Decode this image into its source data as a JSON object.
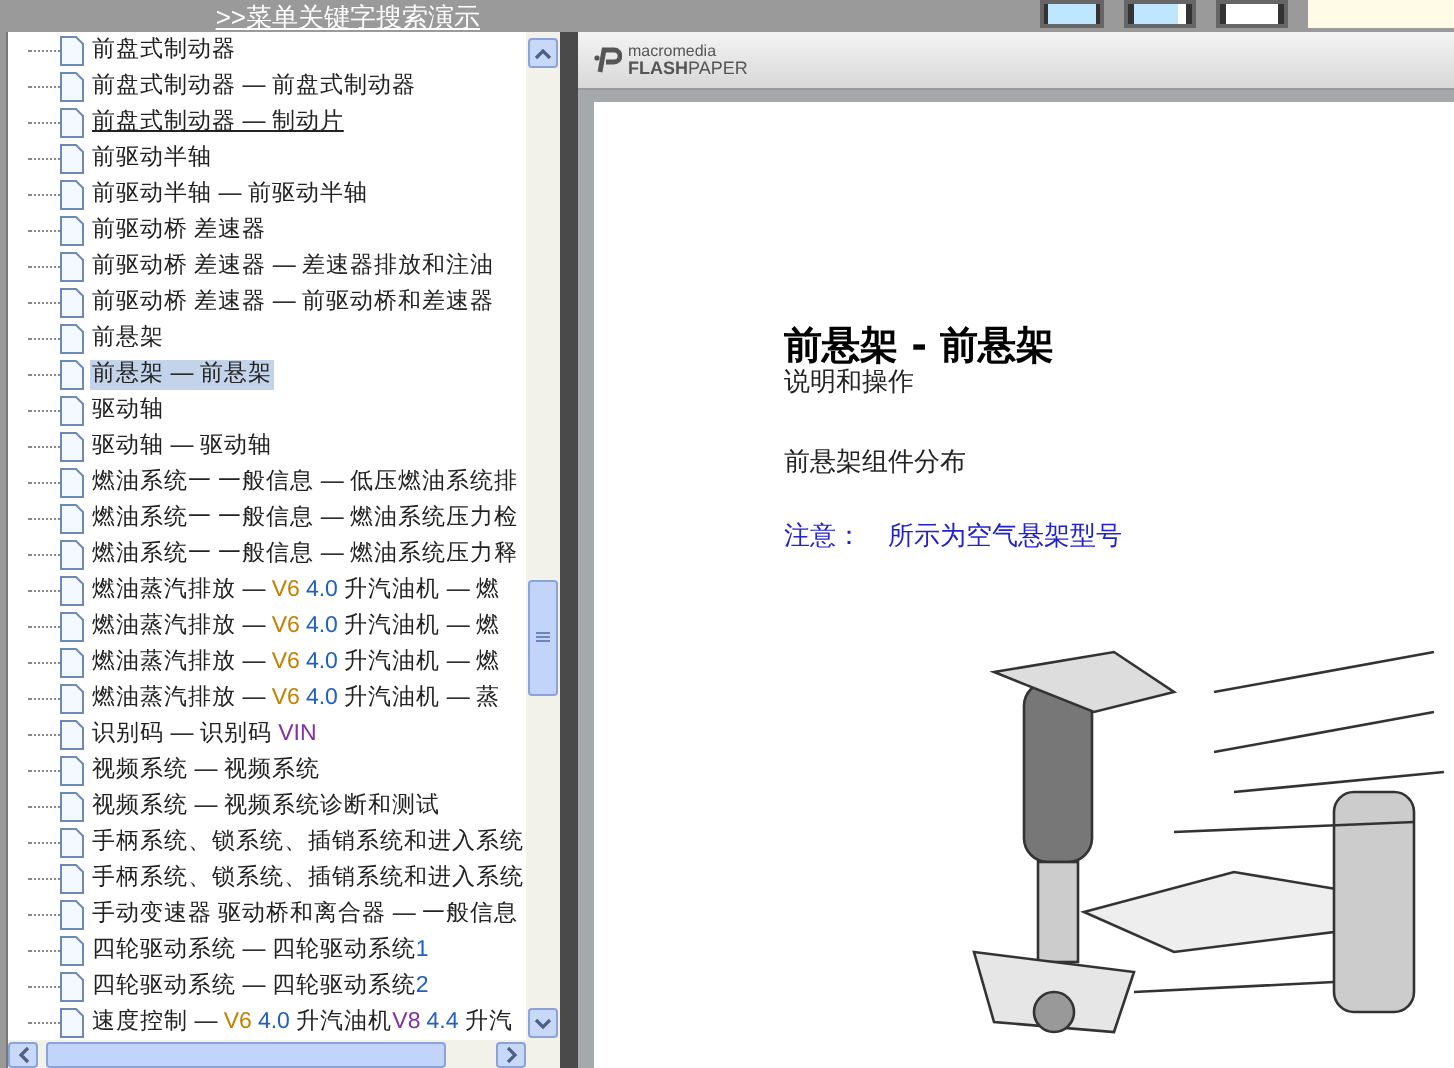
{
  "menu_link": ">>菜单关键字搜索演示",
  "tree_items": [
    {
      "parts": [
        {
          "text": "前盘式制动器"
        }
      ],
      "selected": false,
      "underlined": false
    },
    {
      "parts": [
        {
          "text": "前盘式制动器 — 前盘式制动器"
        }
      ],
      "selected": false,
      "underlined": false
    },
    {
      "parts": [
        {
          "text": "前盘式制动器 — 制动片"
        }
      ],
      "selected": false,
      "underlined": true
    },
    {
      "parts": [
        {
          "text": "前驱动半轴"
        }
      ],
      "selected": false,
      "underlined": false
    },
    {
      "parts": [
        {
          "text": "前驱动半轴 — 前驱动半轴"
        }
      ],
      "selected": false,
      "underlined": false
    },
    {
      "parts": [
        {
          "text": "前驱动桥 差速器"
        }
      ],
      "selected": false,
      "underlined": false
    },
    {
      "parts": [
        {
          "text": "前驱动桥 差速器 — 差速器排放和注油"
        }
      ],
      "selected": false,
      "underlined": false
    },
    {
      "parts": [
        {
          "text": "前驱动桥 差速器 — 前驱动桥和差速器"
        }
      ],
      "selected": false,
      "underlined": false
    },
    {
      "parts": [
        {
          "text": "前悬架"
        }
      ],
      "selected": false,
      "underlined": false
    },
    {
      "parts": [
        {
          "text": "前悬架 — 前悬架"
        }
      ],
      "selected": true,
      "underlined": false
    },
    {
      "parts": [
        {
          "text": "驱动轴"
        }
      ],
      "selected": false,
      "underlined": false
    },
    {
      "parts": [
        {
          "text": "驱动轴 — 驱动轴"
        }
      ],
      "selected": false,
      "underlined": false
    },
    {
      "parts": [
        {
          "text": "燃油系统一 一般信息 — 低压燃油系统排"
        }
      ],
      "selected": false,
      "underlined": false
    },
    {
      "parts": [
        {
          "text": "燃油系统一 一般信息 — 燃油系统压力检"
        }
      ],
      "selected": false,
      "underlined": false
    },
    {
      "parts": [
        {
          "text": "燃油系统一 一般信息 — 燃油系统压力释"
        }
      ],
      "selected": false,
      "underlined": false
    },
    {
      "parts": [
        {
          "text": "燃油蒸汽排放 — "
        },
        {
          "text": "V6",
          "color": "#c08000"
        },
        {
          "text": "4.0",
          "color": "#2060c0"
        },
        {
          "text": " 升汽油机 — 燃"
        }
      ],
      "selected": false,
      "underlined": false
    },
    {
      "parts": [
        {
          "text": "燃油蒸汽排放 — "
        },
        {
          "text": "V6",
          "color": "#c08000"
        },
        {
          "text": "4.0",
          "color": "#2060c0"
        },
        {
          "text": " 升汽油机 — 燃"
        }
      ],
      "selected": false,
      "underlined": false
    },
    {
      "parts": [
        {
          "text": "燃油蒸汽排放 — "
        },
        {
          "text": "V6",
          "color": "#c08000"
        },
        {
          "text": "4.0",
          "color": "#2060c0"
        },
        {
          "text": " 升汽油机 — 燃"
        }
      ],
      "selected": false,
      "underlined": false
    },
    {
      "parts": [
        {
          "text": "燃油蒸汽排放 — "
        },
        {
          "text": "V6",
          "color": "#c08000"
        },
        {
          "text": "4.0",
          "color": "#2060c0"
        },
        {
          "text": " 升汽油机 — 蒸"
        }
      ],
      "selected": false,
      "underlined": false
    },
    {
      "parts": [
        {
          "text": "识别码 — 识别码 "
        },
        {
          "text": "VIN",
          "color": "#8030a0"
        }
      ],
      "selected": false,
      "underlined": false
    },
    {
      "parts": [
        {
          "text": "视频系统 — 视频系统"
        }
      ],
      "selected": false,
      "underlined": false
    },
    {
      "parts": [
        {
          "text": "视频系统 — 视频系统诊断和测试"
        }
      ],
      "selected": false,
      "underlined": false
    },
    {
      "parts": [
        {
          "text": "手柄系统、锁系统、插销系统和进入系统"
        }
      ],
      "selected": false,
      "underlined": false
    },
    {
      "parts": [
        {
          "text": "手柄系统、锁系统、插销系统和进入系统"
        }
      ],
      "selected": false,
      "underlined": false
    },
    {
      "parts": [
        {
          "text": "手动变速器 驱动桥和离合器 — 一般信息"
        }
      ],
      "selected": false,
      "underlined": false
    },
    {
      "parts": [
        {
          "text": "四轮驱动系统 — 四轮驱动系统"
        },
        {
          "text": "1",
          "color": "#2060c0"
        }
      ],
      "selected": false,
      "underlined": false
    },
    {
      "parts": [
        {
          "text": "四轮驱动系统 — 四轮驱动系统"
        },
        {
          "text": "2",
          "color": "#2060c0"
        }
      ],
      "selected": false,
      "underlined": false
    },
    {
      "parts": [
        {
          "text": "速度控制 — "
        },
        {
          "text": "V6",
          "color": "#c08000"
        },
        {
          "text": "4.0",
          "color": "#2060c0"
        },
        {
          "text": " 升汽油机"
        },
        {
          "text": "V8",
          "color": "#8030a0"
        },
        {
          "text": "4.4",
          "color": "#2060c0"
        },
        {
          "text": " 升汽"
        }
      ],
      "selected": false,
      "underlined": false
    }
  ],
  "viewer": {
    "brand_top": "macromedia",
    "brand_bold": "FLASH",
    "brand_light": "PAPER"
  },
  "document": {
    "title": "前悬架 - 前悬架",
    "subtitle": "说明和操作",
    "section": "前悬架组件分布",
    "note": "注意：　所示为空气悬架型号"
  }
}
